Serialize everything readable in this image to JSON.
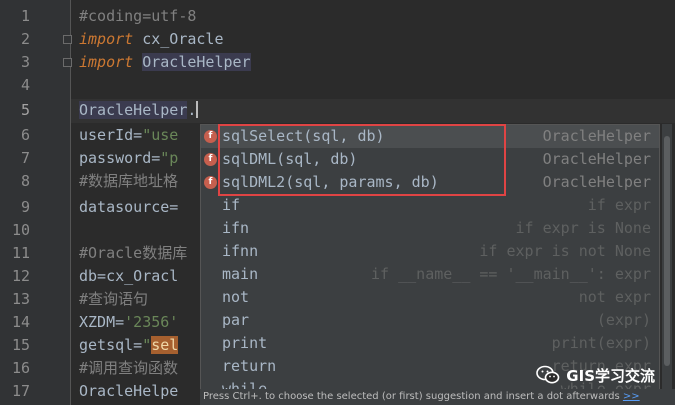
{
  "editor": {
    "line_numbers": [
      "1",
      "2",
      "3",
      "4",
      "5",
      "6",
      "7",
      "8",
      "9",
      "10",
      "11",
      "12",
      "13",
      "14",
      "15",
      "16",
      "17"
    ],
    "lines": {
      "l1": "#coding=utf-8",
      "l2_kw": "import",
      "l2_mod": " cx_Oracle",
      "l3_kw": "import",
      "l3_mod": "OracleHelper",
      "l5_obj": "OracleHelper",
      "l5_dot": ".",
      "l6_a": "userId=",
      "l6_s": "\"use",
      "l7_a": "password=",
      "l7_s": "\"p",
      "l8": "#数据库地址格",
      "l9": "datasource=",
      "l11": "#Oracle数据库",
      "l12": "db=cx_Oracl",
      "l13": "#查询语句",
      "l14_a": "XZDM=",
      "l14_s": "'2356'",
      "l15_a": "getsql=",
      "l15_s": "\"",
      "l15_sel": "sel",
      "l16": "#调用查询函数",
      "l17": "OracleHelpe"
    }
  },
  "completion": {
    "methods": [
      {
        "badge": "f",
        "name": "sqlSelect(sql, db)",
        "type": "OracleHelper"
      },
      {
        "badge": "f",
        "name": "sqlDML(sql, db)",
        "type": "OracleHelper"
      },
      {
        "badge": "f",
        "name": "sqlDML2(sql, params, db)",
        "type": "OracleHelper"
      }
    ],
    "templates": [
      {
        "name": "if",
        "desc": "if expr"
      },
      {
        "name": "ifn",
        "desc": "if expr is None"
      },
      {
        "name": "ifnn",
        "desc": "if expr is not None"
      },
      {
        "name": "main",
        "desc": "if __name__ == '__main__': expr"
      },
      {
        "name": "not",
        "desc": "not expr"
      },
      {
        "name": "par",
        "desc": "(expr)"
      },
      {
        "name": "print",
        "desc": "print(expr)"
      },
      {
        "name": "return",
        "desc": "return expr"
      },
      {
        "name": "while",
        "desc": "while expr"
      }
    ],
    "hint": "Press Ctrl+. to choose the selected (or first) suggestion and insert a dot afterwards",
    "hint_link": ">>"
  },
  "watermark": {
    "text": "GIS学习交流",
    "icon": "wechat-icon"
  },
  "colors": {
    "highlight_box": "#e04444",
    "keyword": "#cc7832",
    "string": "#6a8759",
    "comment": "#808080"
  }
}
